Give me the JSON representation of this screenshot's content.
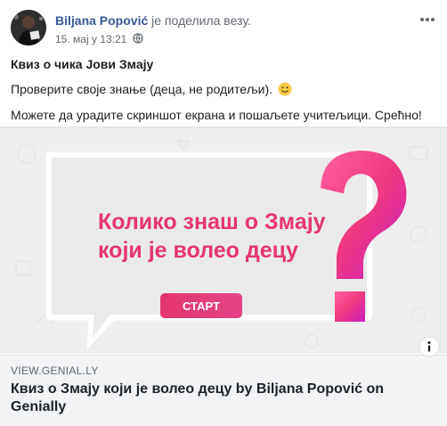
{
  "header": {
    "author": "Biljana Popović",
    "action": "је поделила везу.",
    "timestamp": "15. мај у 13:21"
  },
  "post": {
    "title": "Квиз о чика Јови Змају",
    "line1": "Проверите своје знање (деца, не родитељи).",
    "line2": "Можете да урадите скриншот екрана и пошаљете учитељици. Срећно!"
  },
  "preview": {
    "headline_line1": "Колико знаш о Змају",
    "headline_line2": "који је волео децу",
    "start_label": "СТАРТ",
    "domain": "VIEW.GENIAL.LY",
    "title": "Квиз о Змају који је волео децу by Biljana Popović on Genially"
  },
  "colors": {
    "link_blue": "#385898",
    "accent_pink": "#e6356f",
    "meta_gray": "#616770"
  },
  "icons": {
    "globe": "globe-icon",
    "more": "more-options-icon",
    "emoji": "smiley-emoji-icon",
    "info": "info-icon"
  }
}
